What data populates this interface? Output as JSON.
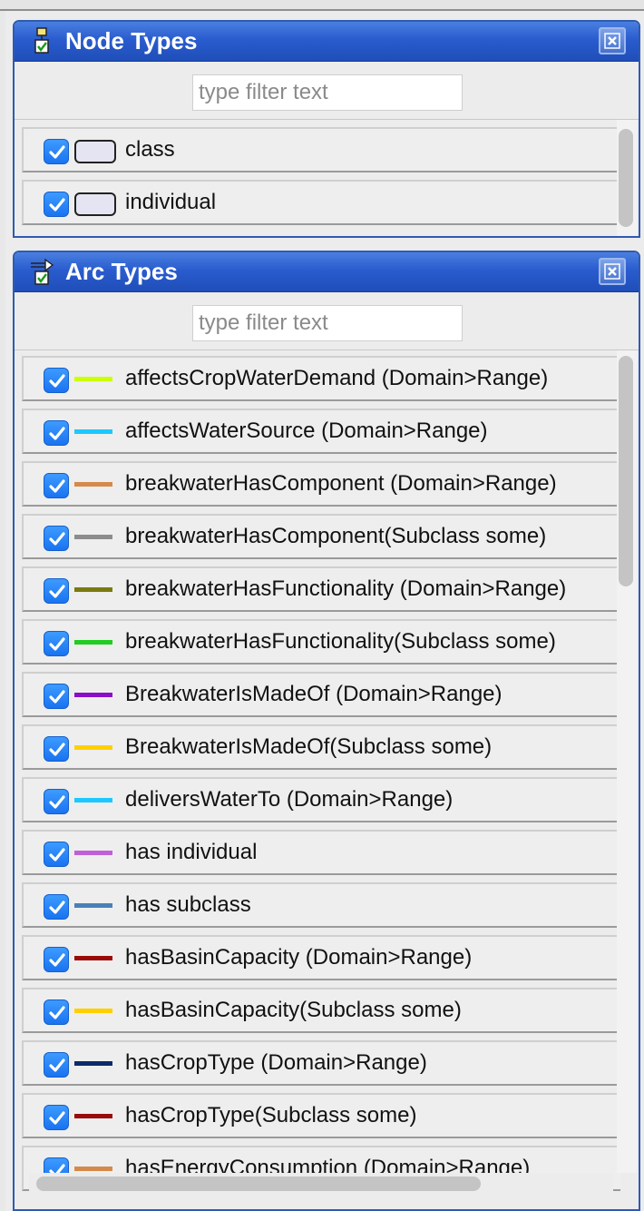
{
  "node_types": {
    "title": "Node Types",
    "icon": "node-types-icon",
    "close_icon": "close-icon",
    "filter": {
      "placeholder": "type filter text",
      "value": ""
    },
    "items": [
      {
        "label": "class",
        "checked": true,
        "shape_color": "#e4e4f3"
      },
      {
        "label": "individual",
        "checked": true,
        "shape_color": "#e4e4f3"
      }
    ]
  },
  "arc_types": {
    "title": "Arc Types",
    "icon": "arc-types-icon",
    "close_icon": "close-icon",
    "filter": {
      "placeholder": "type filter text",
      "value": ""
    },
    "items": [
      {
        "label": "affectsCropWaterDemand (Domain>Range)",
        "checked": true,
        "color": "#ccff00"
      },
      {
        "label": "affectsWaterSource (Domain>Range)",
        "checked": true,
        "color": "#1ec8ff"
      },
      {
        "label": "breakwaterHasComponent (Domain>Range)",
        "checked": true,
        "color": "#d48a4a"
      },
      {
        "label": "breakwaterHasComponent(Subclass some)",
        "checked": true,
        "color": "#8c8c8c"
      },
      {
        "label": "breakwaterHasFunctionality (Domain>Range)",
        "checked": true,
        "color": "#7a7a10"
      },
      {
        "label": "breakwaterHasFunctionality(Subclass some)",
        "checked": true,
        "color": "#22cc22"
      },
      {
        "label": "BreakwaterIsMadeOf (Domain>Range)",
        "checked": true,
        "color": "#8a10c8"
      },
      {
        "label": "BreakwaterIsMadeOf(Subclass some)",
        "checked": true,
        "color": "#ffd000"
      },
      {
        "label": "deliversWaterTo (Domain>Range)",
        "checked": true,
        "color": "#1ec8ff"
      },
      {
        "label": "has individual",
        "checked": true,
        "color": "#c060d8"
      },
      {
        "label": "has subclass",
        "checked": true,
        "color": "#4a80b8"
      },
      {
        "label": "hasBasinCapacity (Domain>Range)",
        "checked": true,
        "color": "#9a0a0a"
      },
      {
        "label": "hasBasinCapacity(Subclass some)",
        "checked": true,
        "color": "#ffd000"
      },
      {
        "label": "hasCropType (Domain>Range)",
        "checked": true,
        "color": "#0a2a6a"
      },
      {
        "label": "hasCropType(Subclass some)",
        "checked": true,
        "color": "#9a0a0a"
      },
      {
        "label": "hasEnergyConsumption (Domain>Range)",
        "checked": true,
        "color": "#d48a4a"
      }
    ]
  }
}
